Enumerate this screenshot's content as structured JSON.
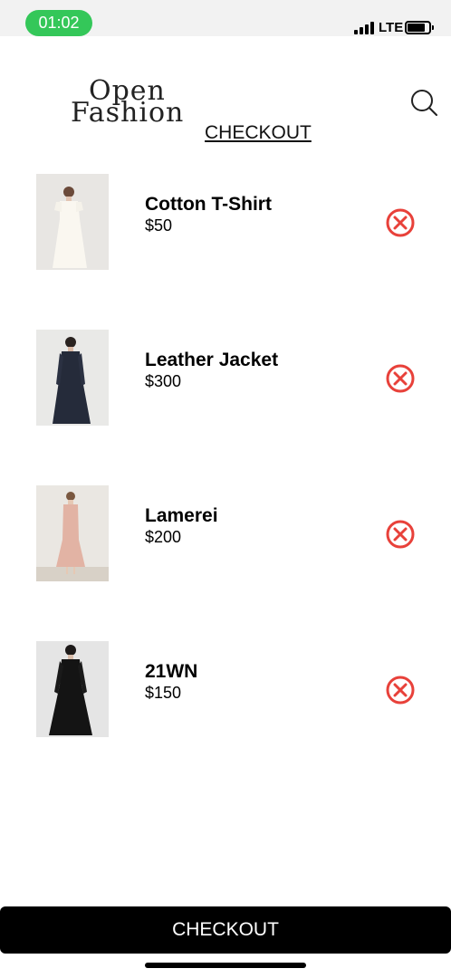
{
  "status_bar": {
    "time": "01:02",
    "carrier": "LTE"
  },
  "header": {
    "logo_line1": "Open",
    "logo_line2": "Fashion",
    "title": "CHECKOUT",
    "search_icon": "search-icon"
  },
  "cart": {
    "items": [
      {
        "name": "Cotton T-Shirt",
        "price": "$50",
        "image": "white-dress-photo"
      },
      {
        "name": "Leather Jacket",
        "price": "$300",
        "image": "navy-dress-photo"
      },
      {
        "name": "Lamerei",
        "price": "$200",
        "image": "pink-dress-photo"
      },
      {
        "name": "21WN",
        "price": "$150",
        "image": "black-dress-photo"
      }
    ],
    "remove_icon": "remove-circle-icon"
  },
  "footer": {
    "checkout_label": "CHECKOUT"
  },
  "colors": {
    "accent_remove": "#e8413a",
    "status_pill": "#34c759",
    "button_bg": "#000000"
  }
}
